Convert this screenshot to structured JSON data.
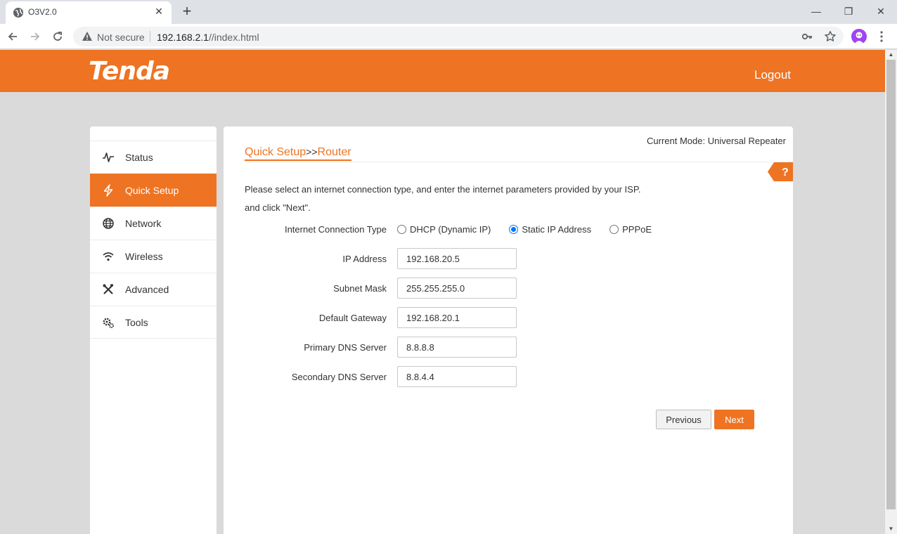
{
  "browser": {
    "tab_title": "O3V2.0",
    "security_label": "Not secure",
    "url_host": "192.168.2.1",
    "url_path": "//index.html",
    "new_tab_glyph": "+",
    "close_glyph": "✕",
    "minimize_glyph": "—",
    "restore_glyph": "❐",
    "window_close_glyph": "✕"
  },
  "header": {
    "logo_text": "Tenda",
    "logout_label": "Logout",
    "brand_color": "#ee7322"
  },
  "sidebar": {
    "items": [
      {
        "label": "Status",
        "icon": "pulse-icon",
        "active": false
      },
      {
        "label": "Quick Setup",
        "icon": "lightning-icon",
        "active": true
      },
      {
        "label": "Network",
        "icon": "globe-icon",
        "active": false
      },
      {
        "label": "Wireless",
        "icon": "wifi-icon",
        "active": false
      },
      {
        "label": "Advanced",
        "icon": "tools-icon",
        "active": false
      },
      {
        "label": "Tools",
        "icon": "gears-icon",
        "active": false
      }
    ]
  },
  "main": {
    "current_mode": "Current Mode: Universal Repeater",
    "breadcrumb": {
      "first": "Quick Setup",
      "separator": ">>",
      "second": "Router"
    },
    "help_label": "?",
    "intro_line1": "Please select an internet connection type, and enter the internet parameters provided by your ISP.",
    "intro_line2": "and click \"Next\".",
    "connection_type": {
      "label": "Internet Connection Type",
      "options": [
        "DHCP (Dynamic IP)",
        "Static IP Address",
        "PPPoE"
      ],
      "selected": "Static IP Address"
    },
    "fields": [
      {
        "label": "IP Address",
        "value": "192.168.20.5"
      },
      {
        "label": "Subnet Mask",
        "value": "255.255.255.0"
      },
      {
        "label": "Default Gateway",
        "value": "192.168.20.1"
      },
      {
        "label": "Primary DNS Server",
        "value": "8.8.8.8"
      },
      {
        "label": "Secondary DNS Server",
        "value": "8.8.4.4"
      }
    ],
    "previous_label": "Previous",
    "next_label": "Next"
  }
}
